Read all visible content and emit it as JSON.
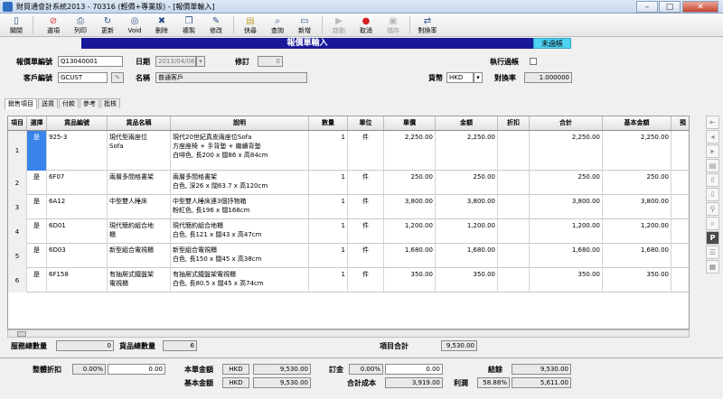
{
  "window": {
    "title": "財貿通會計系統2013 - 70316 (輕價+專業版) - [報價單輸入]",
    "min": "–",
    "max": "□",
    "close": "✕"
  },
  "toolbar": [
    {
      "label": "關閉",
      "icon": "door-icon"
    },
    {
      "label": "選項",
      "icon": "options-icon"
    },
    {
      "label": "列印",
      "icon": "print-icon"
    },
    {
      "label": "更新",
      "icon": "refresh-icon"
    },
    {
      "label": "Void",
      "icon": "void-icon"
    },
    {
      "label": "刪除",
      "icon": "delete-icon"
    },
    {
      "label": "複製",
      "icon": "copy-icon"
    },
    {
      "label": "修改",
      "icon": "edit-icon"
    },
    {
      "label": "快尋",
      "icon": "quick-find-icon"
    },
    {
      "label": "查詢",
      "icon": "search-icon"
    },
    {
      "label": "新增",
      "icon": "new-icon"
    },
    {
      "label": "啟動",
      "icon": "start-icon",
      "disabled": true
    },
    {
      "label": "取消",
      "icon": "cancel-icon"
    },
    {
      "label": "儲存",
      "icon": "save-icon",
      "disabled": true
    },
    {
      "label": "對換率",
      "icon": "exchange-rate-icon"
    }
  ],
  "banner": {
    "title": "報價單輸入",
    "status": "未過帳"
  },
  "header": {
    "quote_no_label": "報價單編號",
    "quote_no": "Q13040001",
    "date_label": "日期",
    "date": "2013/04/08",
    "revision_label": "修訂",
    "revision": "0",
    "execute_label": "執行過帳",
    "customer_code_label": "客戶編號",
    "customer_code": "GCUST",
    "name_label": "名稱",
    "name": "普通客戶",
    "currency_label": "貨幣",
    "currency": "HKD",
    "rate_label": "對換率",
    "rate": "1.000000"
  },
  "tabs": [
    "銷售項目",
    "送貨",
    "付款",
    "參考",
    "批核"
  ],
  "grid": {
    "headers": [
      "項目",
      "選擇",
      "貨品編號",
      "貨品名稱",
      "說明",
      "數量",
      "單位",
      "單價",
      "金額",
      "折扣",
      "合計",
      "基本金額",
      "預"
    ],
    "rows": [
      {
        "no": "1",
        "sel": "是",
        "code": "925-3",
        "name": "現代型兩座位\nSofa",
        "desc": "現代20世紀真皮兩座位Sofa\n方座座椅 + 手背墊 + 繼續背墊\n白啡色, 長200 x 闊86 x 高84cm",
        "qty": "1",
        "unit": "件",
        "price": "2,250.00",
        "amount": "2,250.00",
        "discount": "",
        "total": "2,250.00",
        "base": "2,250.00"
      },
      {
        "no": "2",
        "sel": "是",
        "code": "6F07",
        "name": "兩層多間格書架",
        "desc": "兩層多間格書架\n白色, 深26 x 闊63.7 x 高120cm",
        "qty": "1",
        "unit": "件",
        "price": "250.00",
        "amount": "250.00",
        "discount": "",
        "total": "250.00",
        "base": "250.00"
      },
      {
        "no": "3",
        "sel": "是",
        "code": "6A12",
        "name": "中型雙人睡床",
        "desc": "中型雙人睡床連3個抒物箱\n粉紅色, 長196 x 闊168cm",
        "qty": "1",
        "unit": "件",
        "price": "3,800.00",
        "amount": "3,800.00",
        "discount": "",
        "total": "3,800.00",
        "base": "3,800.00"
      },
      {
        "no": "4",
        "sel": "是",
        "code": "6D01",
        "name": "現代簡約組合地\n櫃",
        "desc": "現代簡約組合地櫃\n白色, 長121 x 闊43 x 高47cm",
        "qty": "1",
        "unit": "件",
        "price": "1,200.00",
        "amount": "1,200.00",
        "discount": "",
        "total": "1,200.00",
        "base": "1,200.00"
      },
      {
        "no": "5",
        "sel": "是",
        "code": "6D03",
        "name": "新型組合電視櫃",
        "desc": "新型組合電視櫃\n白色, 長150 x 闊45 x 高38cm",
        "qty": "1",
        "unit": "件",
        "price": "1,680.00",
        "amount": "1,680.00",
        "discount": "",
        "total": "1,680.00",
        "base": "1,680.00"
      },
      {
        "no": "6",
        "sel": "是",
        "code": "6F158",
        "name": "有抽屜式鐵盤架\n電視櫃",
        "desc": "有抽屜式鐵盤架電視櫃\n白色, 長80.5 x 闊45 x 高74cm",
        "qty": "1",
        "unit": "件",
        "price": "350.00",
        "amount": "350.00",
        "discount": "",
        "total": "350.00",
        "base": "350.00"
      }
    ]
  },
  "summary": {
    "service_qty_label": "服務總數量",
    "service_qty": "0",
    "goods_qty_label": "貨品總數量",
    "goods_qty": "6",
    "items_total_label": "項目合計",
    "items_total": "9,530.00",
    "overall_discount_label": "整體折扣",
    "overall_discount_pct": "0.00%",
    "overall_discount_amt": "0.00",
    "doc_amount_label": "本單金額",
    "doc_currency": "HKD",
    "doc_amount": "9,530.00",
    "deposit_label": "訂金",
    "deposit_pct": "0.00%",
    "deposit_amt": "0.00",
    "balance_label": "結餘",
    "balance": "9,530.00",
    "base_amount_label": "基本金額",
    "base_currency": "HKD",
    "base_amount": "9,530.00",
    "total_cost_label": "合計成本",
    "total_cost": "3,919.00",
    "profit_label": "利潤",
    "profit_pct": "58.88%",
    "profit": "5,611.00"
  }
}
